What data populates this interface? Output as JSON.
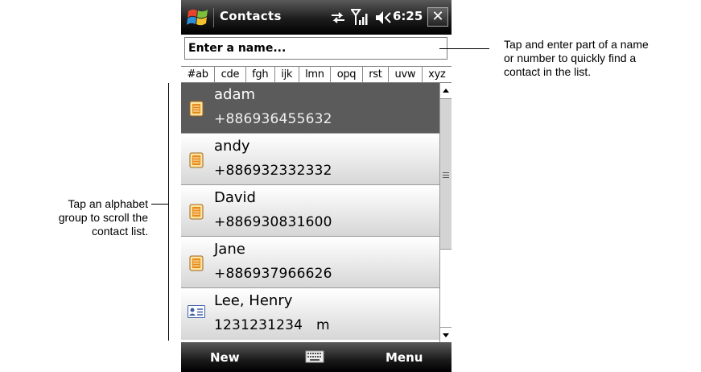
{
  "title_bar": {
    "app_title": "Contacts",
    "time": "6:25",
    "close_label": "✕",
    "icons": [
      "windows-start-icon",
      "sync-icon",
      "signal-icon",
      "volume-icon",
      "close-icon"
    ]
  },
  "search": {
    "placeholder": "Enter a name..."
  },
  "alphabet_groups": [
    "#ab",
    "cde",
    "fgh",
    "ijk",
    "lmn",
    "opq",
    "rst",
    "uvw",
    "xyz"
  ],
  "contacts": [
    {
      "name": "adam",
      "number": "+886936455632",
      "icon": "contact-card-icon",
      "selected": true
    },
    {
      "name": "andy",
      "number": "+886932332332",
      "icon": "contact-card-icon",
      "selected": false
    },
    {
      "name": "David",
      "number": "+886930831600",
      "icon": "contact-card-icon",
      "selected": false
    },
    {
      "name": "Jane",
      "number": "+886937966626",
      "icon": "contact-card-icon",
      "selected": false
    },
    {
      "name": "Lee, Henry",
      "number": "1231231234   m",
      "icon": "business-card-icon",
      "selected": false
    }
  ],
  "softkeys": {
    "left": "New",
    "right": "Menu",
    "center_icon": "keyboard-icon"
  },
  "callouts": {
    "search_help": [
      "Tap and enter part of a name",
      "or number to quickly find a",
      "contact in the list."
    ],
    "alphabet_help": [
      "Tap an alphabet",
      "group to scroll the",
      "contact list."
    ]
  },
  "colors": {
    "selected_row": "#5b5b5b",
    "title_bar": "#1c1c1c",
    "windows_flag": [
      "#e8432b",
      "#7cbf3b",
      "#2d8fd8",
      "#f6c22c"
    ]
  }
}
